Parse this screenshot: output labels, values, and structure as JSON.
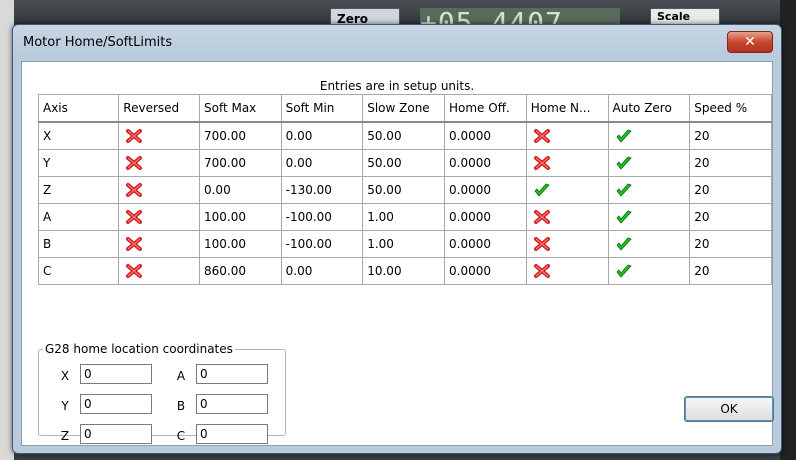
{
  "background": {
    "zero_label": "Zero",
    "dro_value": "+05.4407",
    "scale_label": "Scale"
  },
  "dialog": {
    "title": "Motor Home/SoftLimits",
    "close_symbol": "✕",
    "caption": "Entries are in setup units.",
    "columns": [
      "Axis",
      "Reversed",
      "Soft Max",
      "Soft Min",
      "Slow Zone",
      "Home Off.",
      "Home N...",
      "Auto Zero",
      "Speed %"
    ],
    "rows": [
      {
        "axis": "X",
        "reversed": "no",
        "soft_max": "700.00",
        "soft_min": "0.00",
        "slow_zone": "50.00",
        "home_off": "0.0000",
        "home_neg": "no",
        "auto_zero": "yes",
        "speed": "20"
      },
      {
        "axis": "Y",
        "reversed": "no",
        "soft_max": "700.00",
        "soft_min": "0.00",
        "slow_zone": "50.00",
        "home_off": "0.0000",
        "home_neg": "no",
        "auto_zero": "yes",
        "speed": "20"
      },
      {
        "axis": "Z",
        "reversed": "no",
        "soft_max": "0.00",
        "soft_min": "-130.00",
        "slow_zone": "50.00",
        "home_off": "0.0000",
        "home_neg": "yes",
        "auto_zero": "yes",
        "speed": "20"
      },
      {
        "axis": "A",
        "reversed": "no",
        "soft_max": "100.00",
        "soft_min": "-100.00",
        "slow_zone": "1.00",
        "home_off": "0.0000",
        "home_neg": "no",
        "auto_zero": "yes",
        "speed": "20"
      },
      {
        "axis": "B",
        "reversed": "no",
        "soft_max": "100.00",
        "soft_min": "-100.00",
        "slow_zone": "1.00",
        "home_off": "0.0000",
        "home_neg": "no",
        "auto_zero": "yes",
        "speed": "20"
      },
      {
        "axis": "C",
        "reversed": "no",
        "soft_max": "860.00",
        "soft_min": "0.00",
        "slow_zone": "10.00",
        "home_off": "0.0000",
        "home_neg": "no",
        "auto_zero": "yes",
        "speed": "20"
      }
    ],
    "g28": {
      "legend": "G28 home location coordinates",
      "x_label": "X",
      "x_value": "0",
      "y_label": "Y",
      "y_value": "0",
      "z_label": "Z",
      "z_value": "0",
      "a_label": "A",
      "a_value": "0",
      "b_label": "B",
      "b_value": "0",
      "c_label": "C",
      "c_value": "0"
    },
    "ok_label": "OK"
  },
  "colors": {
    "false_mark": "#d01818",
    "true_mark": "#22c022"
  },
  "icons": {
    "false": "red-x-icon",
    "true": "green-check-icon"
  }
}
